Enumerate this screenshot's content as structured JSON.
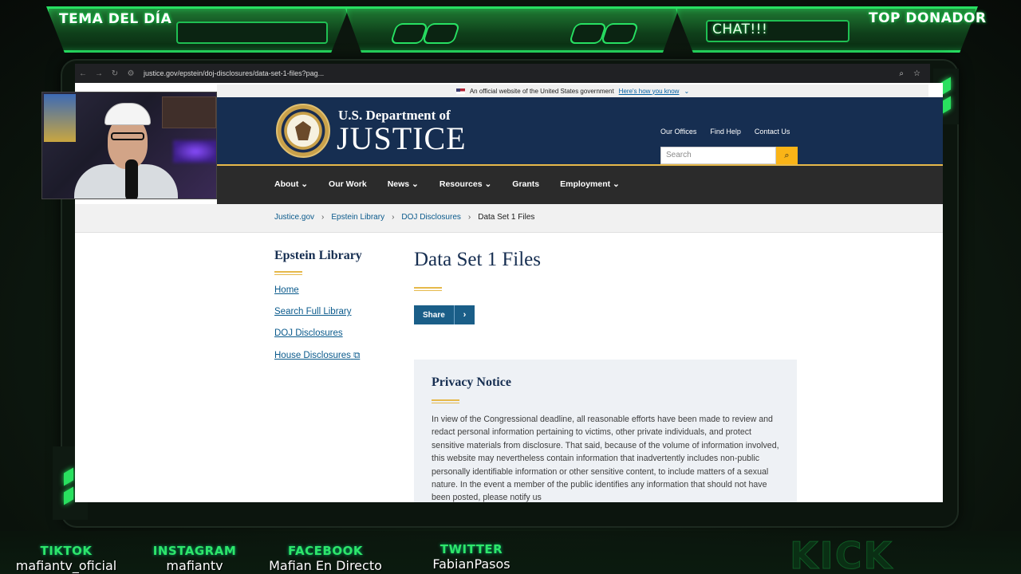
{
  "overlay": {
    "topic_label": "TEMA DEL DÍA",
    "chat_label": "CHAT!!!",
    "top_donor_label": "TOP DONADOR"
  },
  "browser": {
    "url": "justice.gov/epstein/doj-disclosures/data-set-1-files?pag..."
  },
  "gov_banner": {
    "text": "An official website of the United States government",
    "link": "Here's how you know"
  },
  "header": {
    "dept_line": "U.S. Department of",
    "name": "JUSTICE",
    "top_links": [
      "Our Offices",
      "Find Help",
      "Contact Us"
    ],
    "search_placeholder": "Search"
  },
  "nav": {
    "items": [
      "About",
      "Our Work",
      "News",
      "Resources",
      "Grants",
      "Employment"
    ]
  },
  "breadcrumb": [
    "Justice.gov",
    "Epstein Library",
    "DOJ Disclosures",
    "Data Set 1 Files"
  ],
  "sidebar": {
    "title": "Epstein Library",
    "links": [
      "Home",
      "Search Full Library",
      "DOJ Disclosures",
      "House Disclosures"
    ]
  },
  "main": {
    "title": "Data Set 1 Files",
    "share_label": "Share"
  },
  "privacy": {
    "heading": "Privacy Notice",
    "body": "In view of the Congressional deadline, all reasonable efforts have been made to review and redact personal information pertaining to victims, other private individuals, and protect sensitive materials from disclosure. That said, because of the volume of information involved, this website may nevertheless contain information that inadvertently includes non-public personally identifiable information or other sensitive content, to include matters of a sexual nature. In the event a member of the public identifies any information that should not have been posted, please notify us"
  },
  "socials": [
    {
      "network": "TIKTOK",
      "handle": "mafiantv_oficial"
    },
    {
      "network": "INSTAGRAM",
      "handle": "mafiantv"
    },
    {
      "network": "FACEBOOK",
      "handle": "Mafian En Directo"
    },
    {
      "network": "TWITTER",
      "handle": "FabianPasos"
    }
  ],
  "kick_logo": "KICK",
  "colors": {
    "overlay_green": "#27e062",
    "doj_navy": "#162e51",
    "doj_gold": "#e6b94b",
    "link_blue": "#0a5a8c",
    "search_yellow": "#fab417"
  }
}
